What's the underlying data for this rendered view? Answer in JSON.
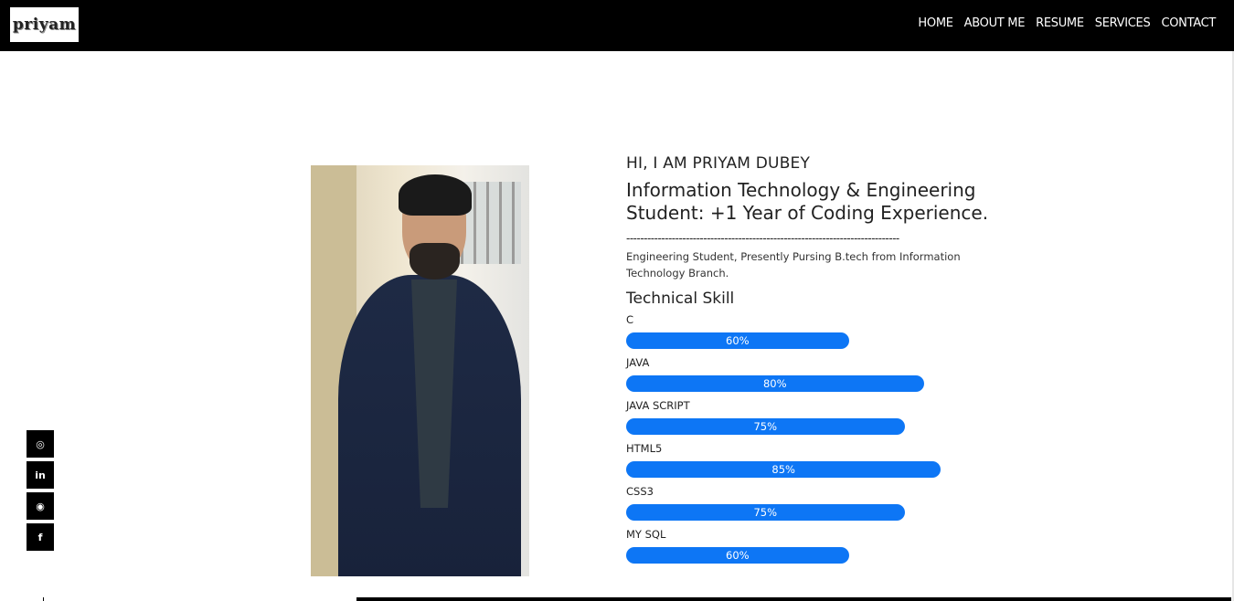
{
  "brand": {
    "logo_text": "priyam"
  },
  "nav": {
    "items": [
      {
        "label": "HOME"
      },
      {
        "label": "ABOUT ME"
      },
      {
        "label": "RESUME"
      },
      {
        "label": "SERVICES"
      },
      {
        "label": "CONTACT"
      }
    ]
  },
  "about": {
    "greeting": "HI, I AM PRIYAM DUBEY",
    "headline": "Information Technology & Engineering Student: +1 Year of Coding Experience.",
    "divider": "------------------------------------------------------------------------------",
    "description": "Engineering Student, Presently Pursing B.tech from Information Technology Branch.",
    "skills_title": "Technical Skill",
    "skills": [
      {
        "name": "C",
        "label": "60%",
        "value": 0.58
      },
      {
        "name": "JAVA",
        "label": "80%",
        "value": 0.775
      },
      {
        "name": "JAVA SCRIPT",
        "label": "75%",
        "value": 0.725
      },
      {
        "name": "HTML5",
        "label": "85%",
        "value": 0.82
      },
      {
        "name": "CSS3",
        "label": "75%",
        "value": 0.725
      },
      {
        "name": "MY SQL",
        "label": "60%",
        "value": 0.58
      }
    ]
  },
  "social": [
    {
      "icon": "instagram-icon",
      "glyph": "◎"
    },
    {
      "icon": "linkedin-icon",
      "glyph": "in"
    },
    {
      "icon": "github-icon",
      "glyph": "◉"
    },
    {
      "icon": "facebook-icon",
      "glyph": "f"
    }
  ],
  "colors": {
    "accent": "#0d76f5",
    "navbar": "#000000"
  }
}
